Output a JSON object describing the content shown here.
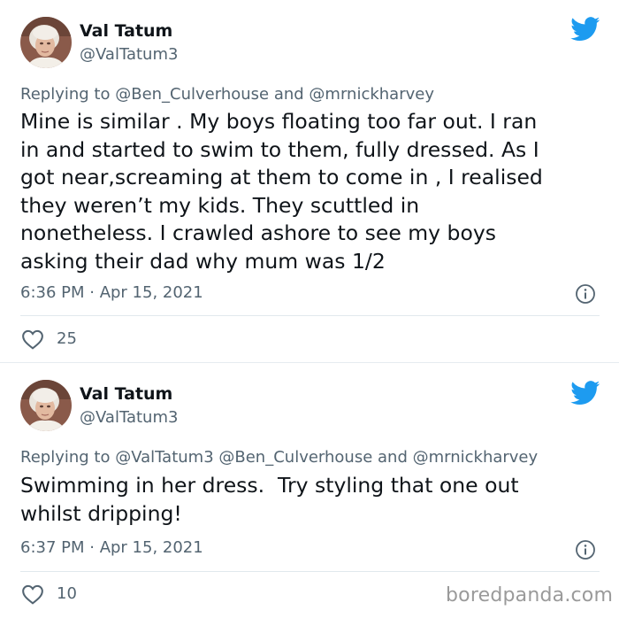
{
  "colors": {
    "accent": "#1d9bf0",
    "secondary_text": "#536471",
    "primary_text": "#0f1419",
    "divider": "#e6ecf0"
  },
  "tweets": [
    {
      "author": {
        "display_name": "Val Tatum",
        "handle": "@ValTatum3",
        "avatar_icon": "profile-photo"
      },
      "reply_prefix": "Replying to",
      "reply_to": "@Ben_Culverhouse and @mrnickharvey",
      "text": "Mine is similar . My boys floating too far out. I ran\nin and started to swim to them, fully dressed. As I\ngot near,screaming at them to come in , I realised\nthey weren’t my kids. They scuttled in\nnonetheless. I crawled ashore to see my boys\nasking their dad why mum was 1/2",
      "timestamp": "6:36 PM · Apr 15, 2021",
      "likes": "25",
      "icons": [
        "twitter-bird-icon",
        "info-icon",
        "heart-icon"
      ]
    },
    {
      "author": {
        "display_name": "Val Tatum",
        "handle": "@ValTatum3",
        "avatar_icon": "profile-photo"
      },
      "reply_prefix": "Replying to",
      "reply_to": "@ValTatum3 @Ben_Culverhouse and @mrnickharvey",
      "text": "Swimming in her dress.  Try styling that one out\nwhilst dripping!",
      "timestamp": "6:37 PM · Apr 15, 2021",
      "likes": "10",
      "icons": [
        "twitter-bird-icon",
        "info-icon",
        "heart-icon"
      ]
    }
  ],
  "watermark": "boredpanda.com"
}
